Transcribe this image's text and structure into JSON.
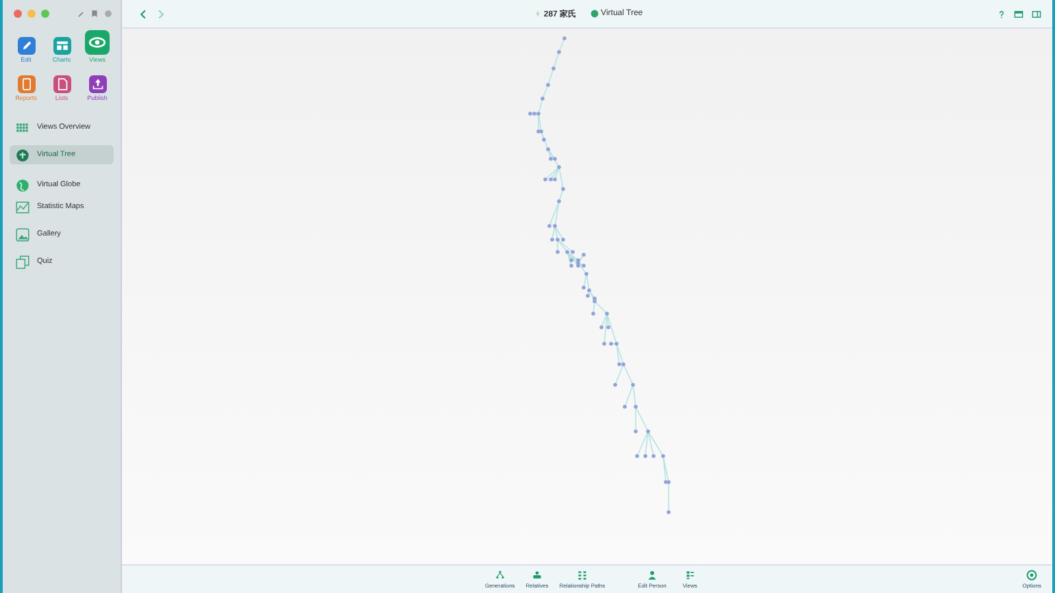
{
  "window": {
    "count": "287 家氏",
    "view_title": "Virtual Tree"
  },
  "sidebar": {
    "tools": [
      {
        "label": "Edit",
        "kind": "edit",
        "color": "#2f7fd6",
        "selected": false
      },
      {
        "label": "Charts",
        "kind": "charts",
        "color": "#1aa3a0",
        "selected": false
      },
      {
        "label": "Views",
        "kind": "views",
        "color": "#19a86a",
        "selected": true
      },
      {
        "label": "Reports",
        "kind": "reports",
        "color": "#e07a2e",
        "selected": false
      },
      {
        "label": "Lists",
        "kind": "lists",
        "color": "#c9507e",
        "selected": false
      },
      {
        "label": "Publish",
        "kind": "publish",
        "color": "#8e3fb8",
        "selected": false
      }
    ],
    "items": [
      {
        "label": "Views Overview",
        "kind": "grid",
        "selected": false
      },
      {
        "label": "Virtual Tree",
        "kind": "tree",
        "selected": true
      },
      {
        "label": "Virtual Globe",
        "kind": "globe",
        "selected": false
      },
      {
        "label": "Statistic Maps",
        "kind": "map",
        "selected": false
      },
      {
        "label": "Gallery",
        "kind": "gallery",
        "selected": false
      },
      {
        "label": "Quiz",
        "kind": "quiz",
        "selected": false
      }
    ]
  },
  "bottom_toolbar": {
    "items": [
      {
        "label": "Generations",
        "kind": "generations"
      },
      {
        "label": "Relatives",
        "kind": "relatives"
      },
      {
        "label": "Relationship Paths",
        "kind": "paths"
      },
      {
        "label": "Edit Person",
        "kind": "person"
      },
      {
        "label": "Views",
        "kind": "views"
      }
    ],
    "options": "Options"
  }
}
